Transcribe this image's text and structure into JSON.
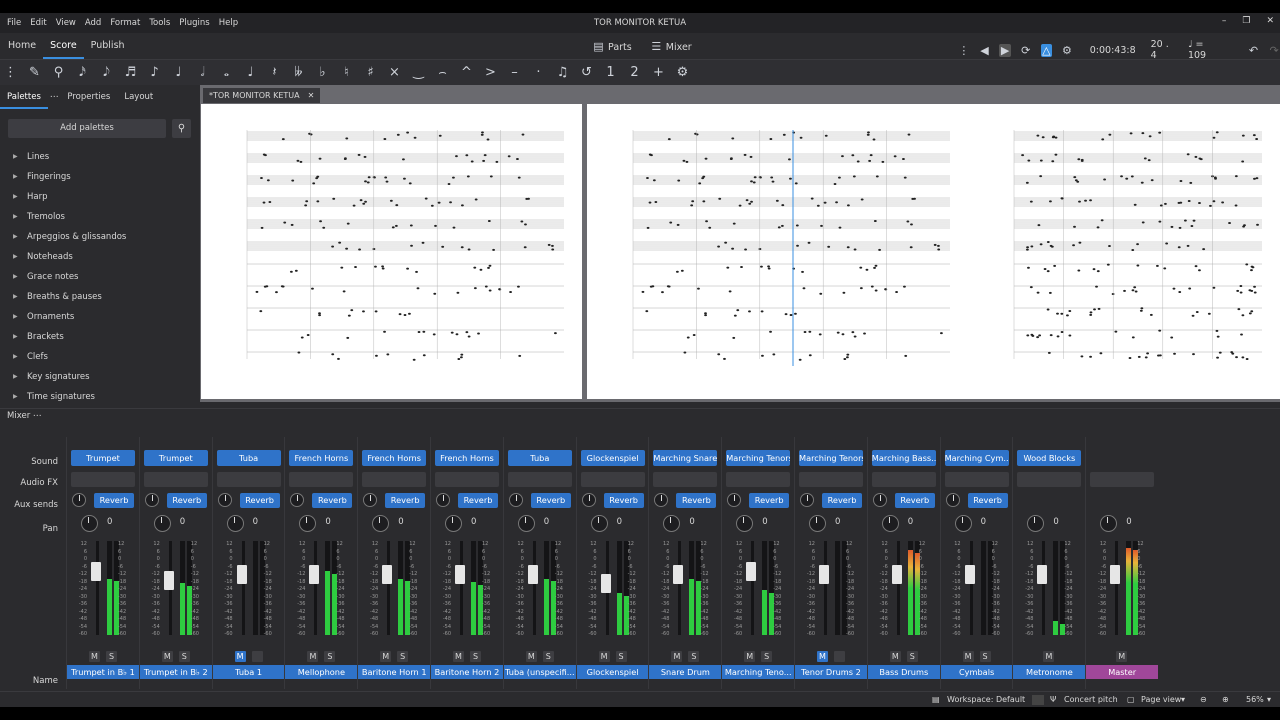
{
  "menu": [
    "File",
    "Edit",
    "View",
    "Add",
    "Format",
    "Tools",
    "Plugins",
    "Help"
  ],
  "window_title": "TOR MONITOR KETUA",
  "workspace_tabs": [
    "Home",
    "Score",
    "Publish"
  ],
  "active_workspace_tab": "Score",
  "center_buttons": {
    "parts": "Parts",
    "mixer": "Mixer"
  },
  "playback": {
    "time": "0:00:43:8",
    "position": "20 . 4",
    "tempo": "♩ = 109"
  },
  "left_panel": {
    "tabs": [
      "Palettes",
      "Properties",
      "Layout"
    ],
    "add_palettes": "Add palettes",
    "palettes": [
      "Lines",
      "Fingerings",
      "Harp",
      "Tremolos",
      "Arpeggios & glissandos",
      "Noteheads",
      "Grace notes",
      "Breaths & pauses",
      "Ornaments",
      "Brackets",
      "Clefs",
      "Key signatures",
      "Time signatures"
    ]
  },
  "document_tab": "*TOR MONITOR KETUA",
  "mixer": {
    "label": "Mixer",
    "row_labels": {
      "sound": "Sound",
      "audio_fx": "Audio FX",
      "aux_sends": "Aux sends",
      "pan": "Pan",
      "name": "Name"
    },
    "reverb_label": "Reverb",
    "channels": [
      {
        "sound": "Trumpet",
        "name": "Trumpet in B♭ 1",
        "pan": "0",
        "level": 0.6,
        "fader": 0.78
      },
      {
        "sound": "Trumpet",
        "name": "Trumpet in B♭ 2",
        "pan": "0",
        "level": 0.55,
        "fader": 0.68
      },
      {
        "sound": "Tuba",
        "name": "Tuba 1",
        "pan": "0",
        "level": 0.0,
        "fader": 0.75,
        "muted": true
      },
      {
        "sound": "French Horns",
        "name": "Mellophone",
        "pan": "0",
        "level": 0.68,
        "fader": 0.75
      },
      {
        "sound": "French Horns",
        "name": "Baritone Horn 1",
        "pan": "0",
        "level": 0.6,
        "fader": 0.75
      },
      {
        "sound": "French Horns",
        "name": "Baritone Horn 2",
        "pan": "0",
        "level": 0.56,
        "fader": 0.75
      },
      {
        "sound": "Tuba",
        "name": "Tuba (unspecifi...",
        "pan": "0",
        "level": 0.6,
        "fader": 0.75
      },
      {
        "sound": "Glockenspiel",
        "name": "Glockenspiel",
        "pan": "0",
        "level": 0.45,
        "fader": 0.65
      },
      {
        "sound": "Marching Snares",
        "name": "Snare Drum",
        "pan": "0",
        "level": 0.6,
        "fader": 0.75
      },
      {
        "sound": "Marching Tenors",
        "name": "Marching Teno...",
        "pan": "0",
        "level": 0.48,
        "fader": 0.78
      },
      {
        "sound": "Marching Tenors",
        "name": "Tenor Drums 2",
        "pan": "0",
        "level": 0.0,
        "fader": 0.75,
        "muted": true
      },
      {
        "sound": "Marching Bass...",
        "name": "Bass Drums",
        "pan": "0",
        "level": 0.9,
        "fader": 0.75,
        "hot": true
      },
      {
        "sound": "Marching Cym...",
        "name": "Cymbals",
        "pan": "0",
        "level": 0.0,
        "fader": 0.75
      },
      {
        "sound": "Wood Blocks",
        "name": "Metronome",
        "pan": "0",
        "level": 0.15,
        "fader": 0.75,
        "noreverb": true
      },
      {
        "sound": "",
        "name": "Master",
        "pan": "0",
        "level": 0.93,
        "fader": 0.75,
        "master": true
      }
    ]
  },
  "status": {
    "workspace": "Workspace: Default",
    "concert_pitch": "Concert pitch",
    "page_view": "Page view",
    "zoom": "56%"
  }
}
